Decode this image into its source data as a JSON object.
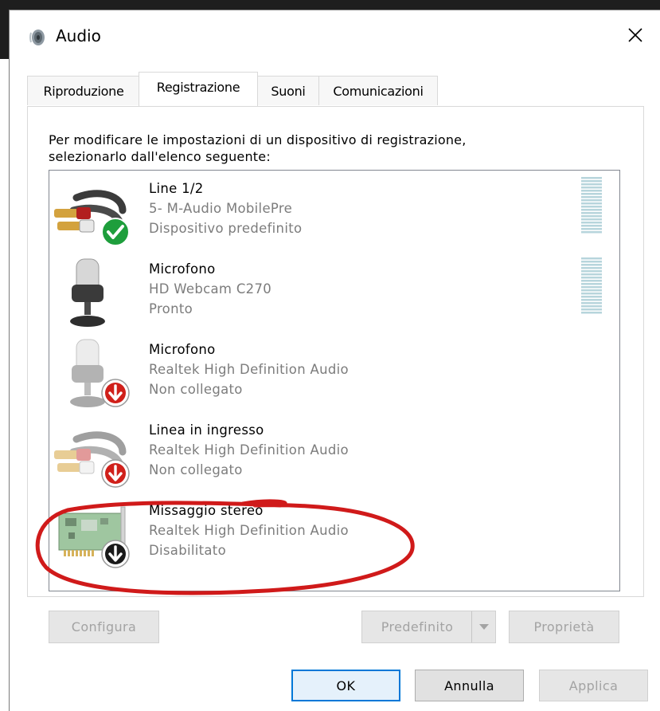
{
  "window": {
    "title": "Audio"
  },
  "tabs": [
    {
      "label": "Riproduzione",
      "active": false
    },
    {
      "label": "Registrazione",
      "active": true
    },
    {
      "label": "Suoni",
      "active": false
    },
    {
      "label": "Comunicazioni",
      "active": false
    }
  ],
  "instructions": {
    "line1": "Per modificare le impostazioni di un dispositivo di registrazione,",
    "line2": "selezionarlo dall'elenco seguente:"
  },
  "devices": [
    {
      "name": "Line 1/2",
      "driver": "5- M-Audio MobilePre",
      "status": "Dispositivo predefinito",
      "icon": "line-in-jack-icon",
      "badge": "check-badge-icon"
    },
    {
      "name": "Microfono",
      "driver": "HD Webcam C270",
      "status": "Pronto",
      "icon": "microphone-icon",
      "badge": ""
    },
    {
      "name": "Microfono",
      "driver": "Realtek High Definition Audio",
      "status": "Non collegato",
      "icon": "microphone-icon",
      "badge": "unplugged-badge-icon"
    },
    {
      "name": "Linea in ingresso",
      "driver": "Realtek High Definition Audio",
      "status": "Non collegato",
      "icon": "line-in-jack-icon",
      "badge": "unplugged-badge-icon"
    },
    {
      "name": "Missaggio stereo",
      "driver": "Realtek High Definition Audio",
      "status": "Disabilitato",
      "icon": "sound-card-icon",
      "badge": "disabled-badge-icon"
    }
  ],
  "buttons": {
    "configure": "Configura",
    "set_default": "Predefinito",
    "properties": "Proprietà",
    "ok": "OK",
    "cancel": "Annulla",
    "apply": "Applica"
  },
  "colors": {
    "accent": "#0078d7",
    "meter": "#b7d5dc",
    "check_badge": "#1e9e3c",
    "unplugged_badge": "#d0201a",
    "annotation": "#d01a1a"
  }
}
